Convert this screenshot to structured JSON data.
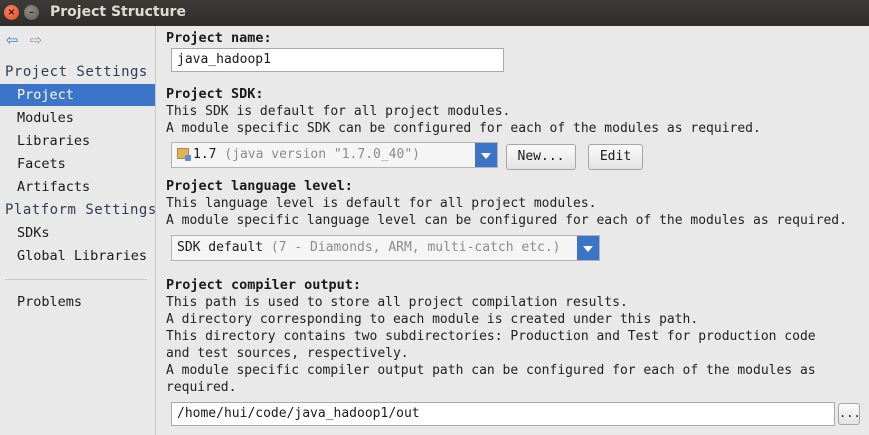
{
  "window": {
    "title": "Project Structure",
    "close_glyph": "×",
    "min_glyph": "–"
  },
  "nav": {
    "back_icon": "back-arrow-icon",
    "forward_icon": "forward-arrow-icon"
  },
  "sidebar": {
    "project_settings_header": "Project Settings",
    "project_items": [
      "Project",
      "Modules",
      "Libraries",
      "Facets",
      "Artifacts"
    ],
    "platform_settings_header": "Platform Settings",
    "platform_items": [
      "SDKs",
      "Global Libraries"
    ],
    "problems": "Problems",
    "selected": "Project"
  },
  "project_name": {
    "label": "Project name:",
    "value": "java_hadoop1"
  },
  "project_sdk": {
    "label": "Project SDK:",
    "desc": [
      "This SDK is default for all project modules.",
      "A module specific SDK can be configured for each of the modules as required."
    ],
    "selected": "1.7",
    "selected_hint": "(java version \"1.7.0_40\")",
    "new_button": "New...",
    "edit_button": "Edit"
  },
  "language_level": {
    "label": "Project language level:",
    "desc": [
      "This language level is default for all project modules.",
      "A module specific language level can be configured for each of the modules as required."
    ],
    "selected": "SDK default",
    "selected_hint": "(7 - Diamonds, ARM, multi-catch etc.)"
  },
  "compiler_output": {
    "label": "Project compiler output:",
    "desc": [
      "This path is used to store all project compilation results.",
      "A directory corresponding to each module is created under this path.",
      "This directory contains two subdirectories: Production and Test for production code",
      "and test sources, respectively.",
      "A module specific compiler output path can be configured for each of the modules as",
      "required."
    ],
    "value": "/home/hui/code/java_hadoop1/out",
    "browse_label": "..."
  },
  "colors": {
    "accent": "#3b74c8",
    "titlebar": "#3c3b37",
    "close": "#e4501e"
  }
}
